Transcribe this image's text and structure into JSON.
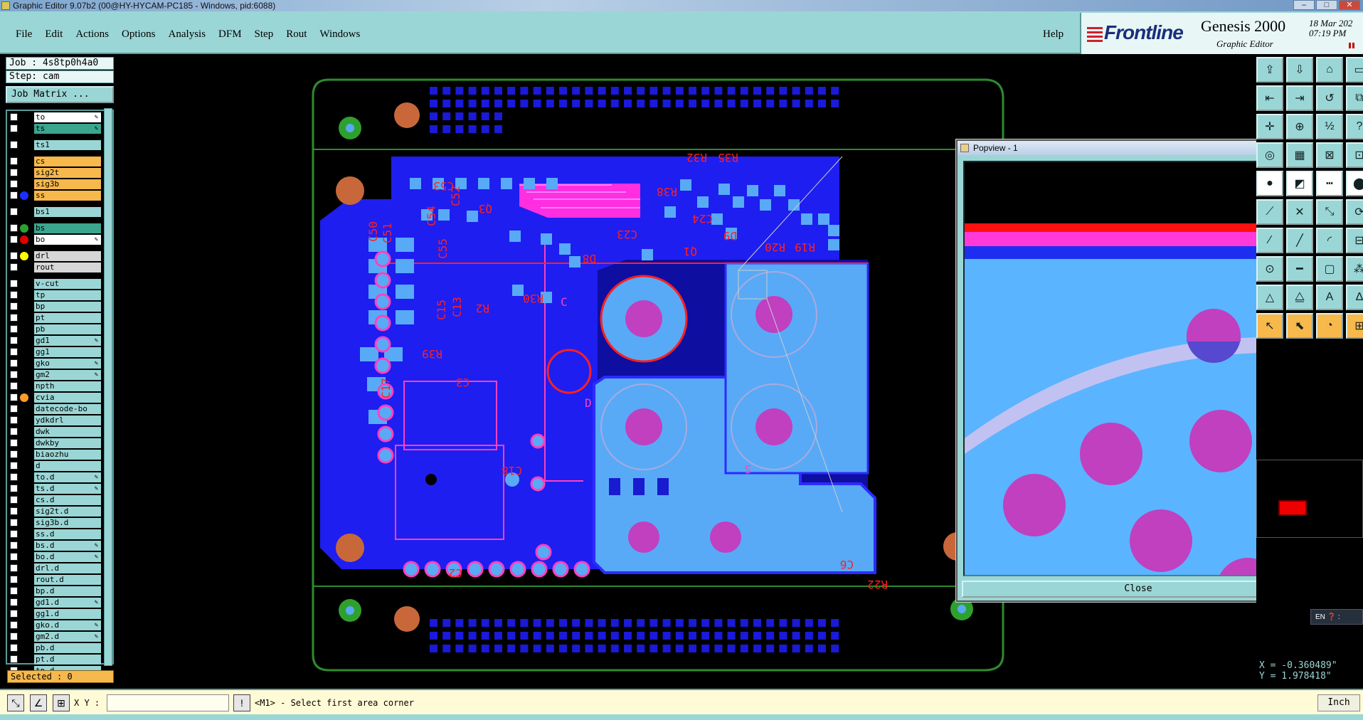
{
  "window": {
    "title": "Graphic Editor 9.07b2 (00@HY-HYCAM-PC185 - Windows, pid:6088)",
    "min": "–",
    "max": "□",
    "close": "✕"
  },
  "menu": {
    "items": [
      "File",
      "Edit",
      "Actions",
      "Options",
      "Analysis",
      "DFM",
      "Step",
      "Rout",
      "Windows"
    ],
    "help": "Help"
  },
  "brand": {
    "logo": "Frontline",
    "product": "Genesis 2000",
    "subtitle": "Graphic Editor",
    "date": "18 Mar 202",
    "time": "07:19 PM"
  },
  "job": {
    "job_label": "Job : 4s8tp0h4a0",
    "step_label": "Step: cam",
    "matrix_button": "Job Matrix ..."
  },
  "layers": [
    {
      "name": "to",
      "style": "white",
      "pen": true
    },
    {
      "name": "ts",
      "style": "teal",
      "pen": true
    },
    {
      "gap": true
    },
    {
      "name": "ts1",
      "style": "normal"
    },
    {
      "gap": true
    },
    {
      "name": "cs",
      "style": "orange"
    },
    {
      "name": "sig2t",
      "style": "orange"
    },
    {
      "name": "sig3b",
      "style": "orange"
    },
    {
      "name": "ss",
      "style": "orange",
      "dot": "#1a2fff"
    },
    {
      "gap": true
    },
    {
      "name": "bs1",
      "style": "normal"
    },
    {
      "gap": true
    },
    {
      "name": "bs",
      "style": "teal",
      "dot": "#2ea02e"
    },
    {
      "name": "bo",
      "style": "white",
      "dot": "#e00000",
      "pen": true
    },
    {
      "gap": true
    },
    {
      "name": "drl",
      "style": "gray",
      "dot": "#ffff00"
    },
    {
      "name": "rout",
      "style": "gray"
    },
    {
      "gap": true
    },
    {
      "name": "v-cut",
      "style": "normal"
    },
    {
      "name": "tp",
      "style": "normal"
    },
    {
      "name": "bp",
      "style": "normal"
    },
    {
      "name": "pt",
      "style": "normal"
    },
    {
      "name": "pb",
      "style": "normal"
    },
    {
      "name": "gd1",
      "style": "normal",
      "pen": true
    },
    {
      "name": "gg1",
      "style": "normal"
    },
    {
      "name": "gko",
      "style": "normal",
      "pen": true
    },
    {
      "name": "gm2",
      "style": "normal",
      "pen": true
    },
    {
      "name": "npth",
      "style": "normal"
    },
    {
      "name": "cvia",
      "style": "normal",
      "dot": "#ff9a2e"
    },
    {
      "name": "datecode-bo",
      "style": "normal"
    },
    {
      "name": "ydkdrl",
      "style": "normal"
    },
    {
      "name": "dwk",
      "style": "normal"
    },
    {
      "name": "dwkby",
      "style": "normal"
    },
    {
      "name": "biaozhu",
      "style": "normal"
    },
    {
      "name": "d",
      "style": "normal"
    },
    {
      "name": "to.d",
      "style": "normal",
      "pen": true
    },
    {
      "name": "ts.d",
      "style": "normal",
      "pen": true
    },
    {
      "name": "cs.d",
      "style": "normal"
    },
    {
      "name": "sig2t.d",
      "style": "normal"
    },
    {
      "name": "sig3b.d",
      "style": "normal"
    },
    {
      "name": "ss.d",
      "style": "normal"
    },
    {
      "name": "bs.d",
      "style": "normal",
      "pen": true
    },
    {
      "name": "bo.d",
      "style": "normal",
      "pen": true
    },
    {
      "name": "drl.d",
      "style": "normal"
    },
    {
      "name": "rout.d",
      "style": "normal"
    },
    {
      "name": "bp.d",
      "style": "normal"
    },
    {
      "name": "gd1.d",
      "style": "normal",
      "pen": true
    },
    {
      "name": "gg1.d",
      "style": "normal"
    },
    {
      "name": "gko.d",
      "style": "normal",
      "pen": true
    },
    {
      "name": "gm2.d",
      "style": "normal",
      "pen": true
    },
    {
      "name": "pb.d",
      "style": "normal"
    },
    {
      "name": "pt.d",
      "style": "normal"
    },
    {
      "name": "tp.d",
      "style": "normal"
    }
  ],
  "selected": "Selected : 0",
  "status": {
    "xy_label": "X Y :",
    "xy_value": "",
    "message": "<M1> - Select first area corner",
    "unit": "Inch"
  },
  "coords": {
    "x": "X = -0.360489\"",
    "y": "Y =  1.978418\""
  },
  "ime": "EN",
  "popview": {
    "title": "Popview - 1",
    "close": "Close",
    "close_x": "✕"
  },
  "pcb_labels": {
    "c50": "C50",
    "c51": "C51",
    "c53": "C53",
    "c54": "C54",
    "c55": "C55",
    "c52": "C52",
    "q3": "Q3",
    "r2": "R2",
    "r30": "R30",
    "c15": "C15",
    "c13": "C13",
    "r39": "R39",
    "c3": "C3",
    "c17": "C17",
    "c18": "C18",
    "c2": "C2",
    "d8": "D8",
    "c23": "C23",
    "r38": "R38",
    "c24": "C24",
    "r32": "R32",
    "r35": "R35",
    "d9": "D9",
    "r19": "R19",
    "r20": "R20",
    "q1": "Q1",
    "c6": "C6",
    "r22": "R22",
    "c": "C",
    "d": "D",
    "s": "S",
    "s_n": "S/N:"
  },
  "colors": {
    "accent": "#9bd6d6",
    "copper": "#2b2bff",
    "pad": "#5ab4ff",
    "mask": "#ff40c0",
    "silk": "#ff2020",
    "outline": "#2e8b2e"
  }
}
